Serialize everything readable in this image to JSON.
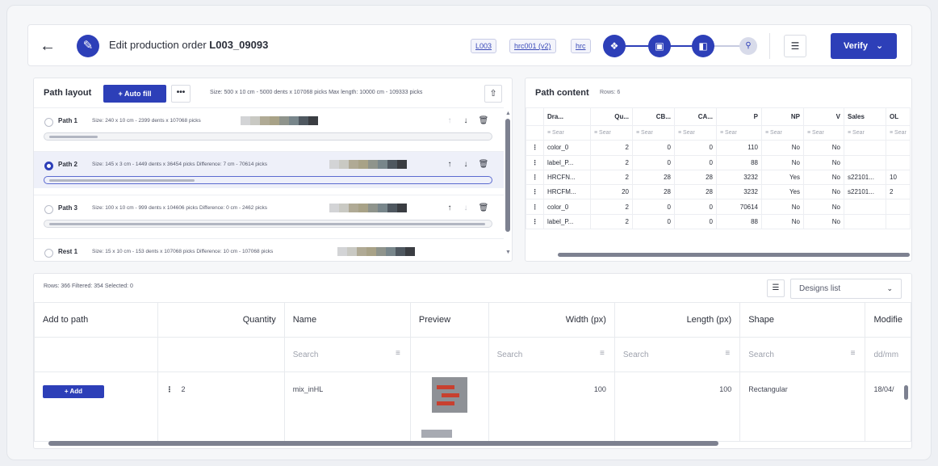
{
  "header": {
    "title_prefix": "Edit production order ",
    "title_code": "L003_09093",
    "chips": [
      "L003",
      "hrc001 (v2)",
      "hrc"
    ],
    "verify_label": "Verify",
    "steps": [
      "step-1",
      "step-2",
      "step-3",
      "step-4"
    ]
  },
  "path_layout": {
    "title": "Path layout",
    "autofill_label": "+ Auto fill",
    "more_label": "•••",
    "info": "Size: 500 x 10 cm - 5000 dents x 107068 picks   Max length: 10000 cm - 109333 picks",
    "paths": [
      {
        "name": "Path 1",
        "info": "Size: 240 x 10 cm - 2399 dents x 107068 picks",
        "selected": false,
        "swatches": [
          "#d3d4d6",
          "#c9c9c3",
          "#b0aa95",
          "#a8a287",
          "#8f948c",
          "#78868b",
          "#4f5860",
          "#3a3d42"
        ]
      },
      {
        "name": "Path 2",
        "info": "Size: 145 x 3 cm - 1449 dents x 36454 picks   Difference: 7 cm - 70614 picks",
        "selected": true,
        "swatches": [
          "#d3d4d6",
          "#c9c9c3",
          "#b0aa95",
          "#a8a287",
          "#8f948c",
          "#78868b",
          "#4f5860",
          "#3a3d42"
        ]
      },
      {
        "name": "Path 3",
        "info": "Size: 100 x 10 cm - 999 dents x 104606 picks   Difference: 0 cm - 2462 picks",
        "selected": false,
        "swatches": [
          "#d3d4d6",
          "#c9c9c3",
          "#b0aa95",
          "#a8a287",
          "#8f948c",
          "#78868b",
          "#4f5860",
          "#3a3d42"
        ]
      },
      {
        "name": "Rest 1",
        "info": "Size: 15 x 10 cm - 153 dents x 107068 picks   Difference: 10 cm - 107068 picks",
        "selected": false,
        "swatches": [
          "#d3d4d6",
          "#c9c9c3",
          "#b0aa95",
          "#a8a287",
          "#8f948c",
          "#78868b",
          "#4f5860",
          "#3a3d42"
        ]
      }
    ]
  },
  "path_content": {
    "title": "Path content",
    "rows_label": "Rows: 6",
    "columns": [
      "Dra...",
      "Qu...",
      "CB...",
      "CA...",
      "P",
      "NP",
      "V",
      "Sales",
      "OL"
    ],
    "filter_placeholder": "Sear",
    "rows": [
      [
        "color_0",
        "2",
        "0",
        "0",
        "110",
        "No",
        "No",
        "",
        ""
      ],
      [
        "label_P...",
        "2",
        "0",
        "0",
        "88",
        "No",
        "No",
        "",
        ""
      ],
      [
        "HRCFN...",
        "2",
        "28",
        "28",
        "3232",
        "Yes",
        "No",
        "s22101...",
        "10"
      ],
      [
        "HRCFM...",
        "20",
        "28",
        "28",
        "3232",
        "Yes",
        "No",
        "s22101...",
        "2"
      ],
      [
        "color_0",
        "2",
        "0",
        "0",
        "70614",
        "No",
        "No",
        "",
        ""
      ],
      [
        "label_P...",
        "2",
        "0",
        "0",
        "88",
        "No",
        "No",
        "",
        ""
      ]
    ]
  },
  "designs": {
    "stats": "Rows: 366   Filtered: 354   Selected: 0",
    "view_select": "Designs list",
    "columns": [
      "Add to path",
      "Quantity",
      "Name",
      "Preview",
      "Width (px)",
      "Length (px)",
      "Shape",
      "Modifie"
    ],
    "search_placeholder": "Search",
    "date_placeholder": "dd/mm",
    "row": {
      "add_label": "+ Add",
      "quantity": "2",
      "name": "mix_inHL",
      "width": "100",
      "length": "100",
      "shape": "Rectangular",
      "modified": "18/04/"
    }
  }
}
